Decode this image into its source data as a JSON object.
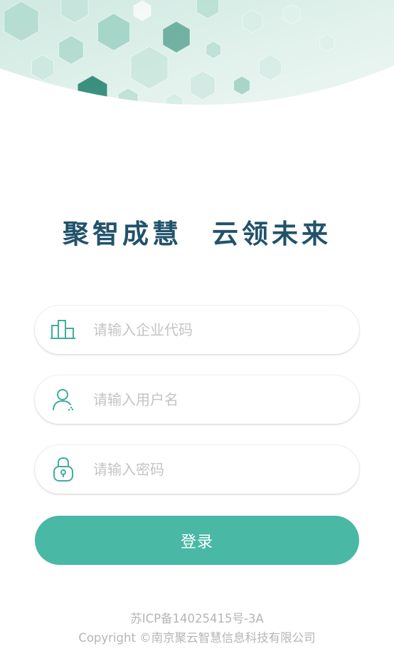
{
  "slogan": "聚智成慧　云领未来",
  "fields": {
    "company": {
      "placeholder": "请输入企业代码",
      "icon": "building-icon"
    },
    "username": {
      "placeholder": "请输入用户名",
      "icon": "user-icon"
    },
    "password": {
      "placeholder": "请输入密码",
      "icon": "lock-icon"
    }
  },
  "login_button": "登录",
  "footer": {
    "icp": "苏ICP备14025415号-3A",
    "copyright": "Copyright ©南京聚云智慧信息科技有限公司"
  },
  "colors": {
    "accent": "#49b8a5",
    "slogan": "#21526b",
    "icon": "#3fae9c"
  }
}
